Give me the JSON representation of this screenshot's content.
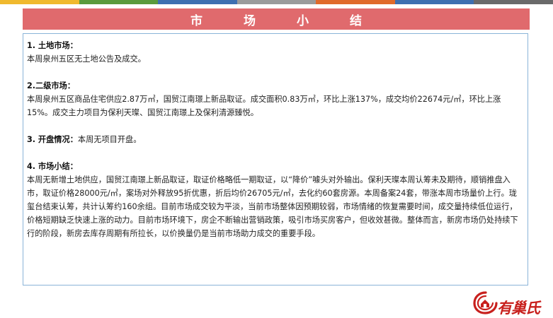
{
  "colors": {
    "stripes": [
      "#f0b92e",
      "#5a9a3c",
      "#3e6fb0",
      "#9b9b9b",
      "#e06a2b",
      "#3e6fb0",
      "#6a6a6a"
    ],
    "title_bar": "#e06a6d",
    "box_border": "#8ab4d8",
    "brand_red": "#c8201d"
  },
  "header": {
    "title": "市场小结"
  },
  "sections": [
    {
      "heading": "1. 土地市场：",
      "body": "本周泉州五区无土地公告及成交。"
    },
    {
      "heading": "2.二级市场：",
      "body": "本周泉州五区商品住宅供应2.87万㎡，国贸江南璟上新品取证。成交面积0.83万㎡，环比上涨137%，成交均价22674元/㎡，环比上涨15%。成交主力项目为保利天璨、国贸江南璟上及保利清源臻悦。"
    },
    {
      "heading": "3. 开盘情况：",
      "body": "本周无项目开盘。"
    },
    {
      "heading": "4. 市场小结：",
      "body": "本周无新增土地供应，国贸江南璟上新品取证，取证价格略低一期取证，以“降价”噱头对外输出。保利天璨本周认筹未及期待，顺销推盘入市，取证价格28000元/㎡，案场对外释放95折优惠，折后均价26705元/㎡，去化约60套房源。本周备案24套，带涨本周市场量价上行。珑玺台结束认筹，共计认筹约160余组。目前市场成交较为平淡，当前市场整体因预期较弱，市场情绪的恢复需要时间，成交量持续低位运行，价格短期缺乏快速上涨的动力。目前市场环境下，房企不断输出营销政策，吸引市场买房客户，但收效甚微。整体而言，新房市场仍处持续下行的阶段，新房去库存周期有所拉长，以价换量仍是当前市场助力成交的重要手段。"
    }
  ],
  "logo": {
    "text": "有巢氏",
    "icon": "house-swirl-logo-icon"
  }
}
